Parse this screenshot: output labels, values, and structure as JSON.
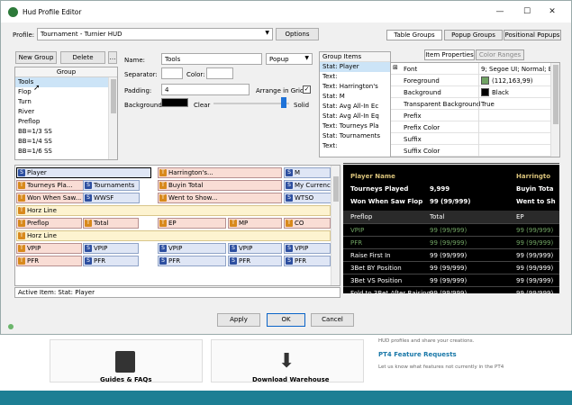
{
  "window": {
    "title": "Hud Profile Editor",
    "minimize": "—",
    "maximize": "☐",
    "close": "✕"
  },
  "profile": {
    "label": "Profile:",
    "value": "Tournament - Turnier HUD",
    "options_button": "Options"
  },
  "top_tabs": [
    "Table Groups",
    "Popup Groups",
    "Positional Popups"
  ],
  "groups": {
    "new_button": "New Group",
    "delete_button": "Delete",
    "header": "Group",
    "items": [
      "Tools",
      "Flop",
      "Turn",
      "River",
      "Preflop",
      "BB=1/3 SS",
      "BB=1/4 SS",
      "BB=1/6 SS"
    ],
    "selected_index": 0
  },
  "form": {
    "name_label": "Name:",
    "name_value": "Tools",
    "type_value": "Popup",
    "separator_label": "Separator:",
    "color_label": "Color:",
    "padding_label": "Padding:",
    "padding_value": "4",
    "arrange_label": "Arrange in Grid",
    "background_label": "Background:",
    "clear_label": "Clear",
    "solid_label": "Solid",
    "background_color": "#000000"
  },
  "group_items": {
    "header": "Group Items",
    "items": [
      "Stat: Player",
      "Text:",
      "Text: Harrington's",
      "Stat: M",
      "Stat: Avg All-In Ec",
      "Stat: Avg All-In Eq",
      "Text: Tourneys Pla",
      "Stat: Tournaments",
      "Text:"
    ],
    "selected_index": 0
  },
  "props": {
    "tabs": [
      "Item Properties",
      "Color Ranges"
    ],
    "rows": [
      {
        "name": "Font",
        "value": "9; Segoe UI; Normal; Bo",
        "expand": "⊞"
      },
      {
        "name": "Foreground",
        "value": "(112,163,99)",
        "swatch": "#70a363"
      },
      {
        "name": "Background",
        "value": "Black",
        "swatch": "#000000"
      },
      {
        "name": "Transparent Background",
        "value": "True"
      },
      {
        "name": "Prefix",
        "value": ""
      },
      {
        "name": "Prefix Color",
        "value": ""
      },
      {
        "name": "Suffix",
        "value": ""
      },
      {
        "name": "Suffix Color",
        "value": ""
      }
    ]
  },
  "layout": {
    "rows": [
      {
        "kind": "cells",
        "cells": [
          {
            "icon": "S",
            "text": "Player",
            "sel": true
          },
          {
            "icon": "T",
            "text": "Harrington's..."
          },
          {
            "icon": "S",
            "text": "M"
          }
        ]
      },
      {
        "kind": "cells",
        "cells": [
          {
            "icon": "T",
            "text": "Tourneys Pla..."
          },
          {
            "icon": "S",
            "text": "Tournaments"
          },
          {
            "icon": "T",
            "text": "Buyin Total"
          },
          {
            "icon": "S",
            "text": "My Currency ..."
          }
        ]
      },
      {
        "kind": "cells",
        "cells": [
          {
            "icon": "T",
            "text": "Won When Saw..."
          },
          {
            "icon": "S",
            "text": "WWSF"
          },
          {
            "icon": "T",
            "text": "Went to Show..."
          },
          {
            "icon": "S",
            "text": "WTSO"
          }
        ]
      },
      {
        "kind": "line",
        "text": "Horz Line"
      },
      {
        "kind": "cells",
        "cells": [
          {
            "icon": "T",
            "text": "Preflop"
          },
          {
            "icon": "T",
            "text": "Total"
          },
          {
            "icon": "T",
            "text": "EP"
          },
          {
            "icon": "T",
            "text": "MP"
          },
          {
            "icon": "T",
            "text": "CO"
          }
        ]
      },
      {
        "kind": "line",
        "text": "Horz Line"
      },
      {
        "kind": "cells",
        "cells": [
          {
            "icon": "T",
            "text": "VPIP"
          },
          {
            "icon": "S",
            "text": "VPIP"
          },
          {
            "icon": "S",
            "text": "VPIP"
          },
          {
            "icon": "S",
            "text": "VPIP"
          },
          {
            "icon": "S",
            "text": "VPIP"
          }
        ]
      },
      {
        "kind": "cells",
        "cells": [
          {
            "icon": "T",
            "text": "PFR"
          },
          {
            "icon": "S",
            "text": "PFR"
          },
          {
            "icon": "S",
            "text": "PFR"
          },
          {
            "icon": "S",
            "text": "PFR"
          },
          {
            "icon": "S",
            "text": "PFR"
          }
        ]
      }
    ]
  },
  "active_item": "Active Item: Stat: Player",
  "hud": {
    "rows": [
      {
        "c1": "Player Name",
        "c2": "",
        "c3": "Harringto",
        "color": "#d9c27a"
      },
      {
        "c1": "Tourneys Played",
        "c2": "9,999",
        "c3": "Buyin Tota",
        "color": "#ffffff"
      },
      {
        "c1": "Won When Saw Flop",
        "c2": "99 (99/999)",
        "c3": "Went to Sh",
        "color": "#ffffff"
      },
      {
        "c1": "Preflop",
        "c2": "Total",
        "c3": "EP",
        "color": "#ffffff",
        "header": true
      },
      {
        "c1": "VPIP",
        "c2": "99 (99/999)",
        "c3": "99 (99/999)",
        "color": "#70a363"
      },
      {
        "c1": "PFR",
        "c2": "99 (99/999)",
        "c3": "99 (99/999)",
        "color": "#70a363"
      },
      {
        "c1": "Raise First In",
        "c2": "99 (99/999)",
        "c3": "99 (99/999)",
        "color": "#ffffff"
      },
      {
        "c1": "3Bet BY Position",
        "c2": "99 (99/999)",
        "c3": "99 (99/999)",
        "color": "#ffffff"
      },
      {
        "c1": "3Bet VS Position",
        "c2": "99 (99/999)",
        "c3": "99 (99/999)",
        "color": "#ffffff"
      },
      {
        "c1": "Fold to 3Bet After Raising",
        "c2": "99 (99/999)",
        "c3": "99 (99/999)",
        "color": "#ffffff"
      }
    ]
  },
  "footer": {
    "apply": "Apply",
    "ok": "OK",
    "cancel": "Cancel"
  },
  "page_behind": {
    "card1": "Guides & FAQs",
    "card2": "Download Warehouse",
    "text1": "HUD profiles and share your creations.",
    "link": "PT4 Feature Requests",
    "text2": "Let us know what features not currently in the PT4"
  }
}
